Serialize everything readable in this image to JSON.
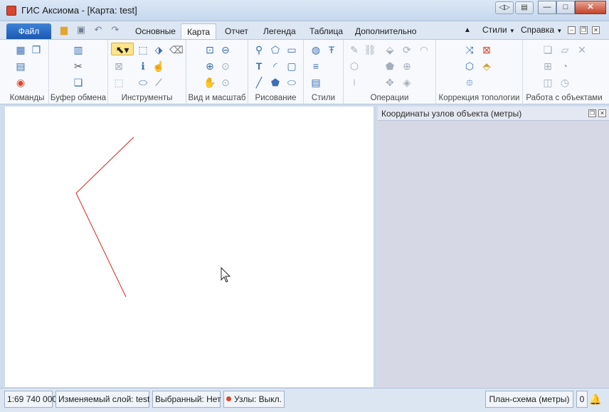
{
  "window": {
    "title": "ГИС Аксиома - [Карта: test]"
  },
  "titlebar_buttons": {
    "nav": "◁▷",
    "save": "▤",
    "minimize": "—",
    "maximize": "□",
    "close": "✕"
  },
  "ribbon": {
    "file_label": "Файл",
    "tabs": [
      "Основные",
      "Карта",
      "Отчет",
      "Легенда",
      "Таблица",
      "Дополнительно"
    ],
    "active_tab": "Карта",
    "right": {
      "styles_label": "Стили",
      "help_label": "Справка"
    },
    "groups": [
      {
        "label": "Команды"
      },
      {
        "label": "Буфер обмена"
      },
      {
        "label": "Инструменты"
      },
      {
        "label": "Вид и масштаб"
      },
      {
        "label": "Рисование"
      },
      {
        "label": "Стили"
      },
      {
        "label": "Операции"
      },
      {
        "label": "Коррекция топологии"
      },
      {
        "label": "Работа с объектами"
      }
    ]
  },
  "panel": {
    "title": "Координаты узлов объекта (метры)"
  },
  "map": {
    "line_color": "#e0281c"
  },
  "statusbar": {
    "scale": "1:69 740 000",
    "editable_layer": "Изменяемый слой: test",
    "selected": "Выбранный: Нет",
    "nodes": "Узлы: Выкл.",
    "projection": "План-схема (метры)",
    "notifications_count": "0"
  },
  "colors": {
    "accent": "#1b58b2",
    "panel_bg": "#d7d8e6",
    "node_dot": "#d9462e"
  }
}
